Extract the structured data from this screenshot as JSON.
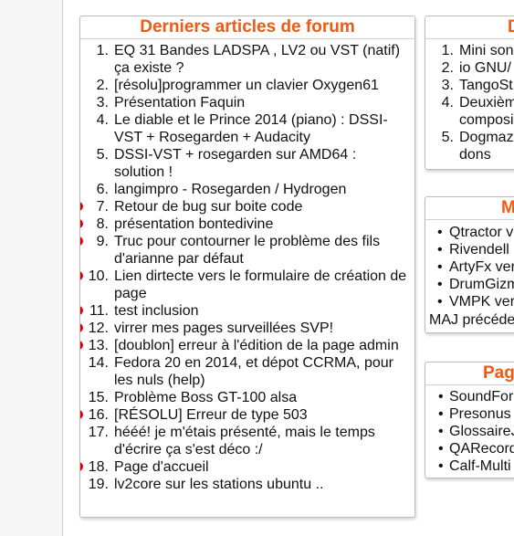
{
  "forum_box": {
    "title": "Derniers articles de forum",
    "items": [
      {
        "num": "1.",
        "text": "EQ 31 Bandes LADSPA , LV2 ou VST (natif) ça existe ?",
        "marked": false
      },
      {
        "num": "2.",
        "text": "[résolu]programmer un clavier Oxygen61",
        "marked": false
      },
      {
        "num": "3.",
        "text": "Présentation Faquin",
        "marked": false
      },
      {
        "num": "4.",
        "text": "Le diable et le Prince 2014 (piano) : DSSI-VST + Rosegarden + Audacity",
        "marked": false
      },
      {
        "num": "5.",
        "text": "DSSI-VST + rosegarden sur AMD64 : solution !",
        "marked": false
      },
      {
        "num": "6.",
        "text": "langimpro - Rosegarden / Hydrogen",
        "marked": false
      },
      {
        "num": "7.",
        "text": "Retour de bug sur boite code",
        "marked": true
      },
      {
        "num": "8.",
        "text": "présentation bontedivine",
        "marked": true
      },
      {
        "num": "9.",
        "text": "Truc pour contourner le problème des fils d'arianne par défaut",
        "marked": true
      },
      {
        "num": "10.",
        "text": "Lien dirtecte vers le formulaire de création de page",
        "marked": true
      },
      {
        "num": "11.",
        "text": "test inclusion",
        "marked": true
      },
      {
        "num": "12.",
        "text": "virrer mes pages surveillées SVP!",
        "marked": true
      },
      {
        "num": "13.",
        "text": "[doublon] erreur à l'édition de la page admin",
        "marked": true
      },
      {
        "num": "14.",
        "text": "Fedora 20 en 2014, et dépot CCRMA, pour les nuls (help)",
        "marked": false
      },
      {
        "num": "15.",
        "text": "Problème Boss GT-100 alsa",
        "marked": false
      },
      {
        "num": "16.",
        "text": "[RÉSOLU] Erreur de type 503",
        "marked": true
      },
      {
        "num": "17.",
        "text": "hééé! je m'étais présenté, mais le temps d'écrire ça s'est déco :/",
        "marked": false
      },
      {
        "num": "18.",
        "text": "Page d'accueil",
        "marked": true
      },
      {
        "num": "19.",
        "text": "lv2core sur les stations ubuntu ..",
        "marked": false
      }
    ]
  },
  "right_box_1": {
    "title": "D",
    "items": [
      {
        "num": "1.",
        "text": "Mini son"
      },
      {
        "num": "2.",
        "text": "io GNU/"
      },
      {
        "num": "3.",
        "text": "TangoSt"
      },
      {
        "num": "4.",
        "text": "Deuxièm"
      },
      {
        "num": "",
        "text": "composi"
      },
      {
        "num": "5.",
        "text": "Dogmaz"
      },
      {
        "num": "",
        "text": "dons"
      }
    ]
  },
  "right_box_2": {
    "title": "M",
    "items": [
      "Qtractor v",
      "Rivendell",
      "ArtyFx ver",
      "DrumGizm",
      "VMPK ver"
    ],
    "footer": "MAJ précéde"
  },
  "right_box_3": {
    "title": "Pag",
    "items": [
      "SoundFor",
      "Presonus",
      "GlossaireJ",
      "QARecord",
      "Calf-Multi"
    ]
  },
  "colors": {
    "title": "#f05a14",
    "marker": "#dd0000"
  }
}
